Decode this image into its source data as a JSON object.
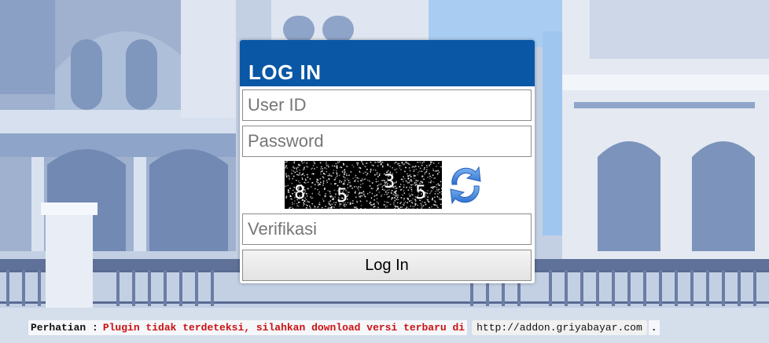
{
  "login": {
    "title": "LOG IN",
    "userid_placeholder": "User ID",
    "password_placeholder": "Password",
    "verification_placeholder": "Verifikasi",
    "submit_label": "Log In",
    "captcha_digits": [
      "8",
      "5",
      "3",
      "5"
    ]
  },
  "notice": {
    "prefix": "Perhatian :",
    "message": "Plugin tidak terdeteksi, silahkan download versi terbaru di",
    "link": "http://addon.griyabayar.com",
    "suffix": "."
  },
  "colors": {
    "header": "#0a57a6",
    "notice_red": "#cc1111",
    "background_blue": "#b9c8df"
  },
  "icons": {
    "refresh": "refresh-icon"
  }
}
